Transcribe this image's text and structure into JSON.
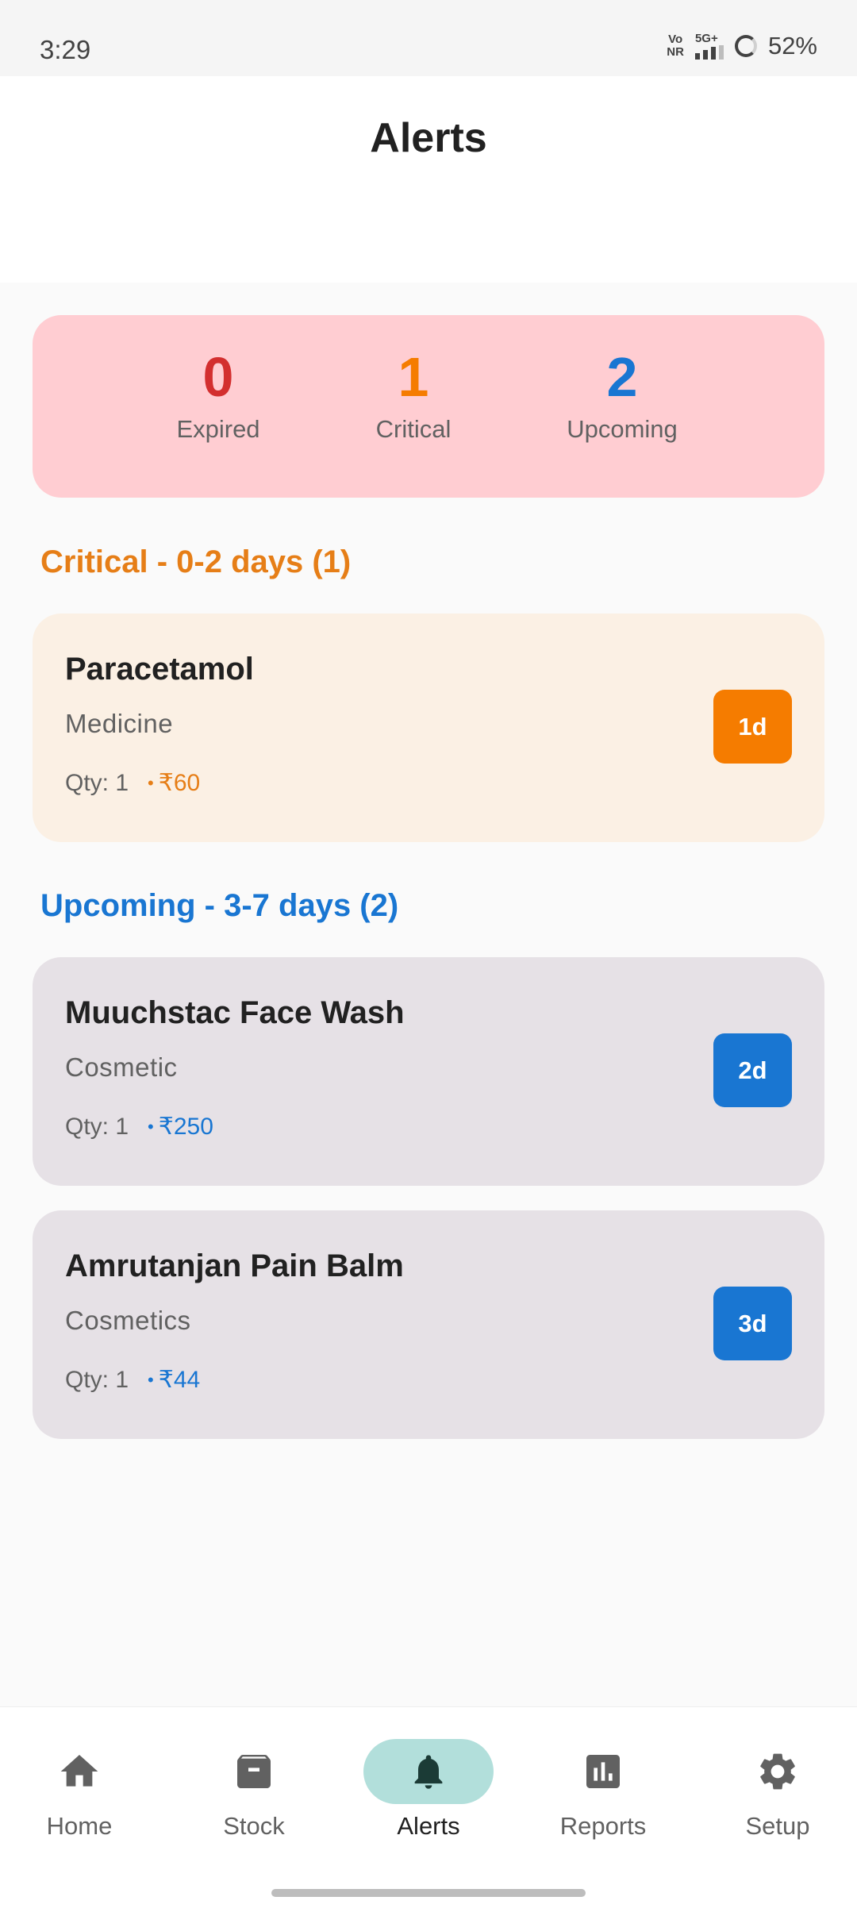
{
  "status_bar": {
    "time": "3:29",
    "network_top": "Vo",
    "network_bottom": "NR",
    "signal_label": "5G+",
    "battery": "52%"
  },
  "header": {
    "title": "Alerts"
  },
  "summary": {
    "expired": {
      "value": "0",
      "label": "Expired",
      "color": "#d32f2f"
    },
    "critical": {
      "value": "1",
      "label": "Critical",
      "color": "#f57c00"
    },
    "upcoming": {
      "value": "2",
      "label": "Upcoming",
      "color": "#1976d2"
    }
  },
  "sections": {
    "critical": {
      "heading": "Critical - 0-2 days (1)",
      "color": "#e67e17",
      "items": [
        {
          "name": "Paracetamol",
          "category": "Medicine",
          "qty": "Qty: 1",
          "price": "₹60",
          "badge": "1d"
        }
      ]
    },
    "upcoming": {
      "heading": "Upcoming - 3-7 days (2)",
      "color": "#1976d2",
      "items": [
        {
          "name": "Muuchstac Face Wash",
          "category": "Cosmetic",
          "qty": "Qty: 1",
          "price": "₹250",
          "badge": "2d"
        },
        {
          "name": "Amrutanjan Pain Balm",
          "category": "Cosmetics",
          "qty": "Qty: 1",
          "price": "₹44",
          "badge": "3d"
        }
      ]
    }
  },
  "colors": {
    "critical_card_bg": "#fbf0e4",
    "upcoming_card_bg": "#e6e1e6",
    "critical_badge": "#f57c00",
    "upcoming_badge": "#1976d2",
    "summary_bg": "#ffcdd2",
    "nav_active_pill": "#b2dfdb"
  },
  "nav": {
    "items": [
      {
        "label": "Home",
        "icon": "home-icon"
      },
      {
        "label": "Stock",
        "icon": "archive-box-icon"
      },
      {
        "label": "Alerts",
        "icon": "bell-icon",
        "active": true
      },
      {
        "label": "Reports",
        "icon": "bar-chart-icon"
      },
      {
        "label": "Setup",
        "icon": "gear-icon"
      }
    ]
  }
}
